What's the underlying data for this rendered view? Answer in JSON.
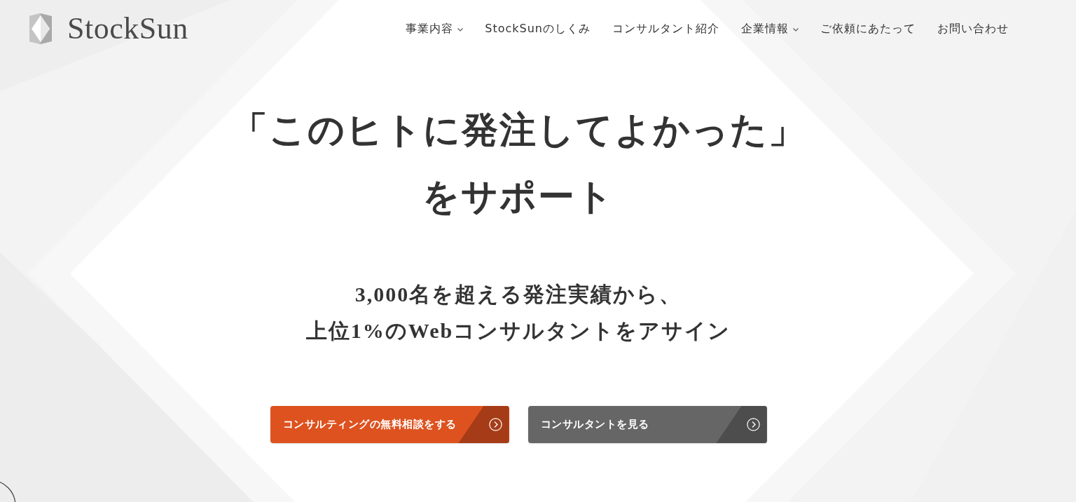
{
  "header": {
    "logo": {
      "text": "StockSun"
    },
    "nav": [
      {
        "label": "事業内容",
        "has_dropdown": true
      },
      {
        "label": "StockSunのしくみ",
        "has_dropdown": false
      },
      {
        "label": "コンサルタント紹介",
        "has_dropdown": false
      },
      {
        "label": "企業情報",
        "has_dropdown": true
      },
      {
        "label": "ご依頼にあたって",
        "has_dropdown": false
      },
      {
        "label": "お問い合わせ",
        "has_dropdown": false
      }
    ]
  },
  "hero": {
    "headline_lines": [
      "「このヒトに発注してよかった」",
      "をサポート"
    ],
    "subtitle_lines": [
      "3,000名を超える発注実績から、",
      "上位1%のWebコンサルタントをアサイン"
    ],
    "buttons": [
      {
        "label": "コンサルティングの無料相談をする",
        "kind": "primary"
      },
      {
        "label": "コンサルタントを見る",
        "kind": "secondary"
      }
    ]
  }
}
